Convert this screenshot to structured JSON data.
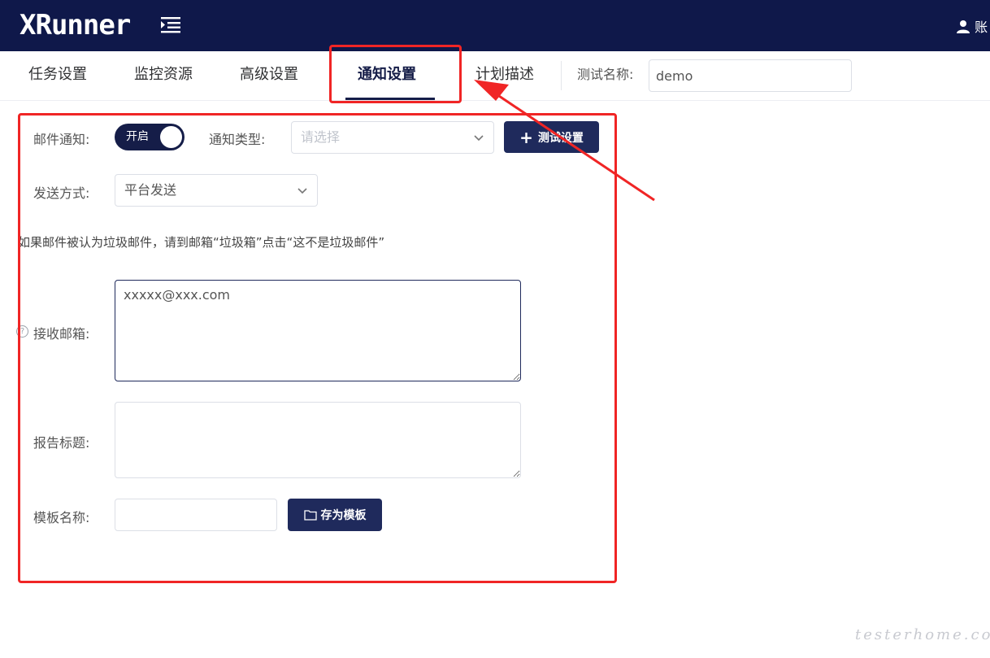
{
  "header": {
    "logo_text": "XRunner",
    "user_text": "账"
  },
  "tabs": [
    {
      "label": "任务设置"
    },
    {
      "label": "监控资源"
    },
    {
      "label": "高级设置"
    },
    {
      "label": "通知设置"
    },
    {
      "label": "计划描述"
    }
  ],
  "active_tab": "通知设置",
  "test_name": {
    "label": "测试名称:",
    "value": "demo"
  },
  "form": {
    "email_notify": {
      "label": "邮件通知:",
      "switch_text": "开启"
    },
    "notify_type": {
      "label": "通知类型:",
      "placeholder": "请选择"
    },
    "test_settings_button": "测试设置",
    "send_method": {
      "label": "发送方式:",
      "value": "平台发送"
    },
    "spam_hint": "如果邮件被认为垃圾邮件，请到邮箱“垃圾箱”点击“这不是垃圾邮件”",
    "receive_email": {
      "label": "接收邮箱:",
      "value": "xxxxx@xxx.com"
    },
    "report_title": {
      "label": "报告标题:",
      "value": ""
    },
    "template_name": {
      "label": "模板名称:",
      "value": ""
    },
    "save_template_button": "存为模板"
  },
  "watermark": "testerhome.com",
  "colors": {
    "navbar": "#0f184a",
    "primary": "#1f2a5c",
    "annotation": "#f02525"
  }
}
